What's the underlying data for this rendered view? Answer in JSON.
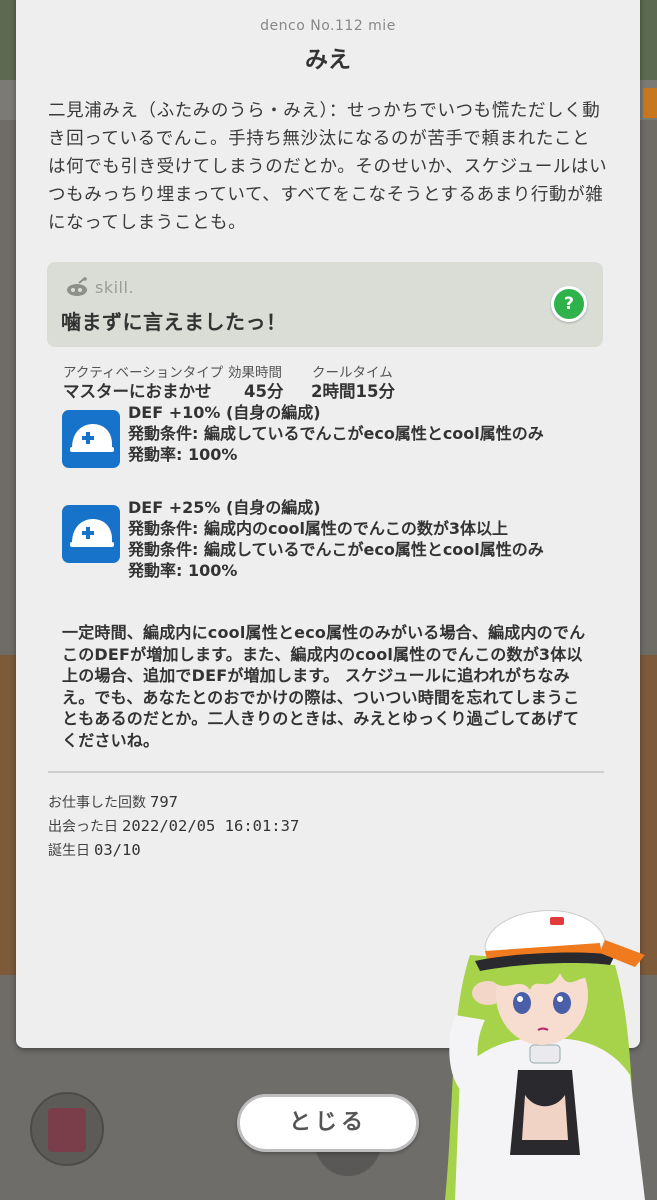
{
  "header": {
    "subtitle": "denco No.112 mie",
    "title": "みえ"
  },
  "description": "二見浦みえ（ふたみのうら・みえ）：せっかちでいつも慌ただしく動き回っているでんこ。手持ち無沙汰になるのが苦手で頼まれたことは何でも引き受けてしまうのだとか。そのせいか、スケジュールはいつもみっちり埋まっていて、すべてをこなそうとするあまり行動が雑になってしまうことも。",
  "skill": {
    "label": "skill.",
    "name": "噛まずに言えましたっ！",
    "help_icon": "?",
    "activation_type_label": "アクティベーションタイプ",
    "activation_type_value": "マスターにおまかせ",
    "duration_label": "効果時間",
    "duration_value": "45分",
    "cooldown_label": "クールタイム",
    "cooldown_value": "2時間15分"
  },
  "effects": [
    {
      "icon": "helmet-plus-icon",
      "lines": [
        "DEF +10% (自身の編成)",
        "発動条件: 編成しているでんこがeco属性とcool属性のみ",
        "発動率: 100%"
      ]
    },
    {
      "icon": "helmet-plus-icon",
      "lines": [
        "DEF +25% (自身の編成)",
        "発動条件: 編成内のcool属性のでんこの数が3体以上",
        "発動条件: 編成しているでんこがeco属性とcool属性のみ",
        "発動率: 100%"
      ]
    }
  ],
  "summary": "一定時間、編成内にcool属性とeco属性のみがいる場合、編成内のでんこのDEFが増加します。また、編成内のcool属性のでんこの数が3体以上の場合、追加でDEFが増加します。 スケジュールに追われがちなみえ。でも、あなたとのおでかけの際は、ついつい時間を忘れてしまうこともあるのだとか。二人きりのときは、みえとゆっくり過ごしてあげてくださいね。",
  "info": {
    "work_count_label": "お仕事した回数",
    "work_count_value": "797",
    "met_date_label": "出会った日",
    "met_date_value": "2022/02/05 16:01:37",
    "birthday_label": "誕生日",
    "birthday_value": "03/10"
  },
  "close_button": "とじる",
  "colors": {
    "modal_bg": "#eeeeee",
    "skill_box_bg": "#d9ddd6",
    "help_green": "#2eb24a",
    "effect_icon_blue": "#1673c9",
    "character_hair": "#a7d34a",
    "hat_accent": "#f07a1e"
  }
}
